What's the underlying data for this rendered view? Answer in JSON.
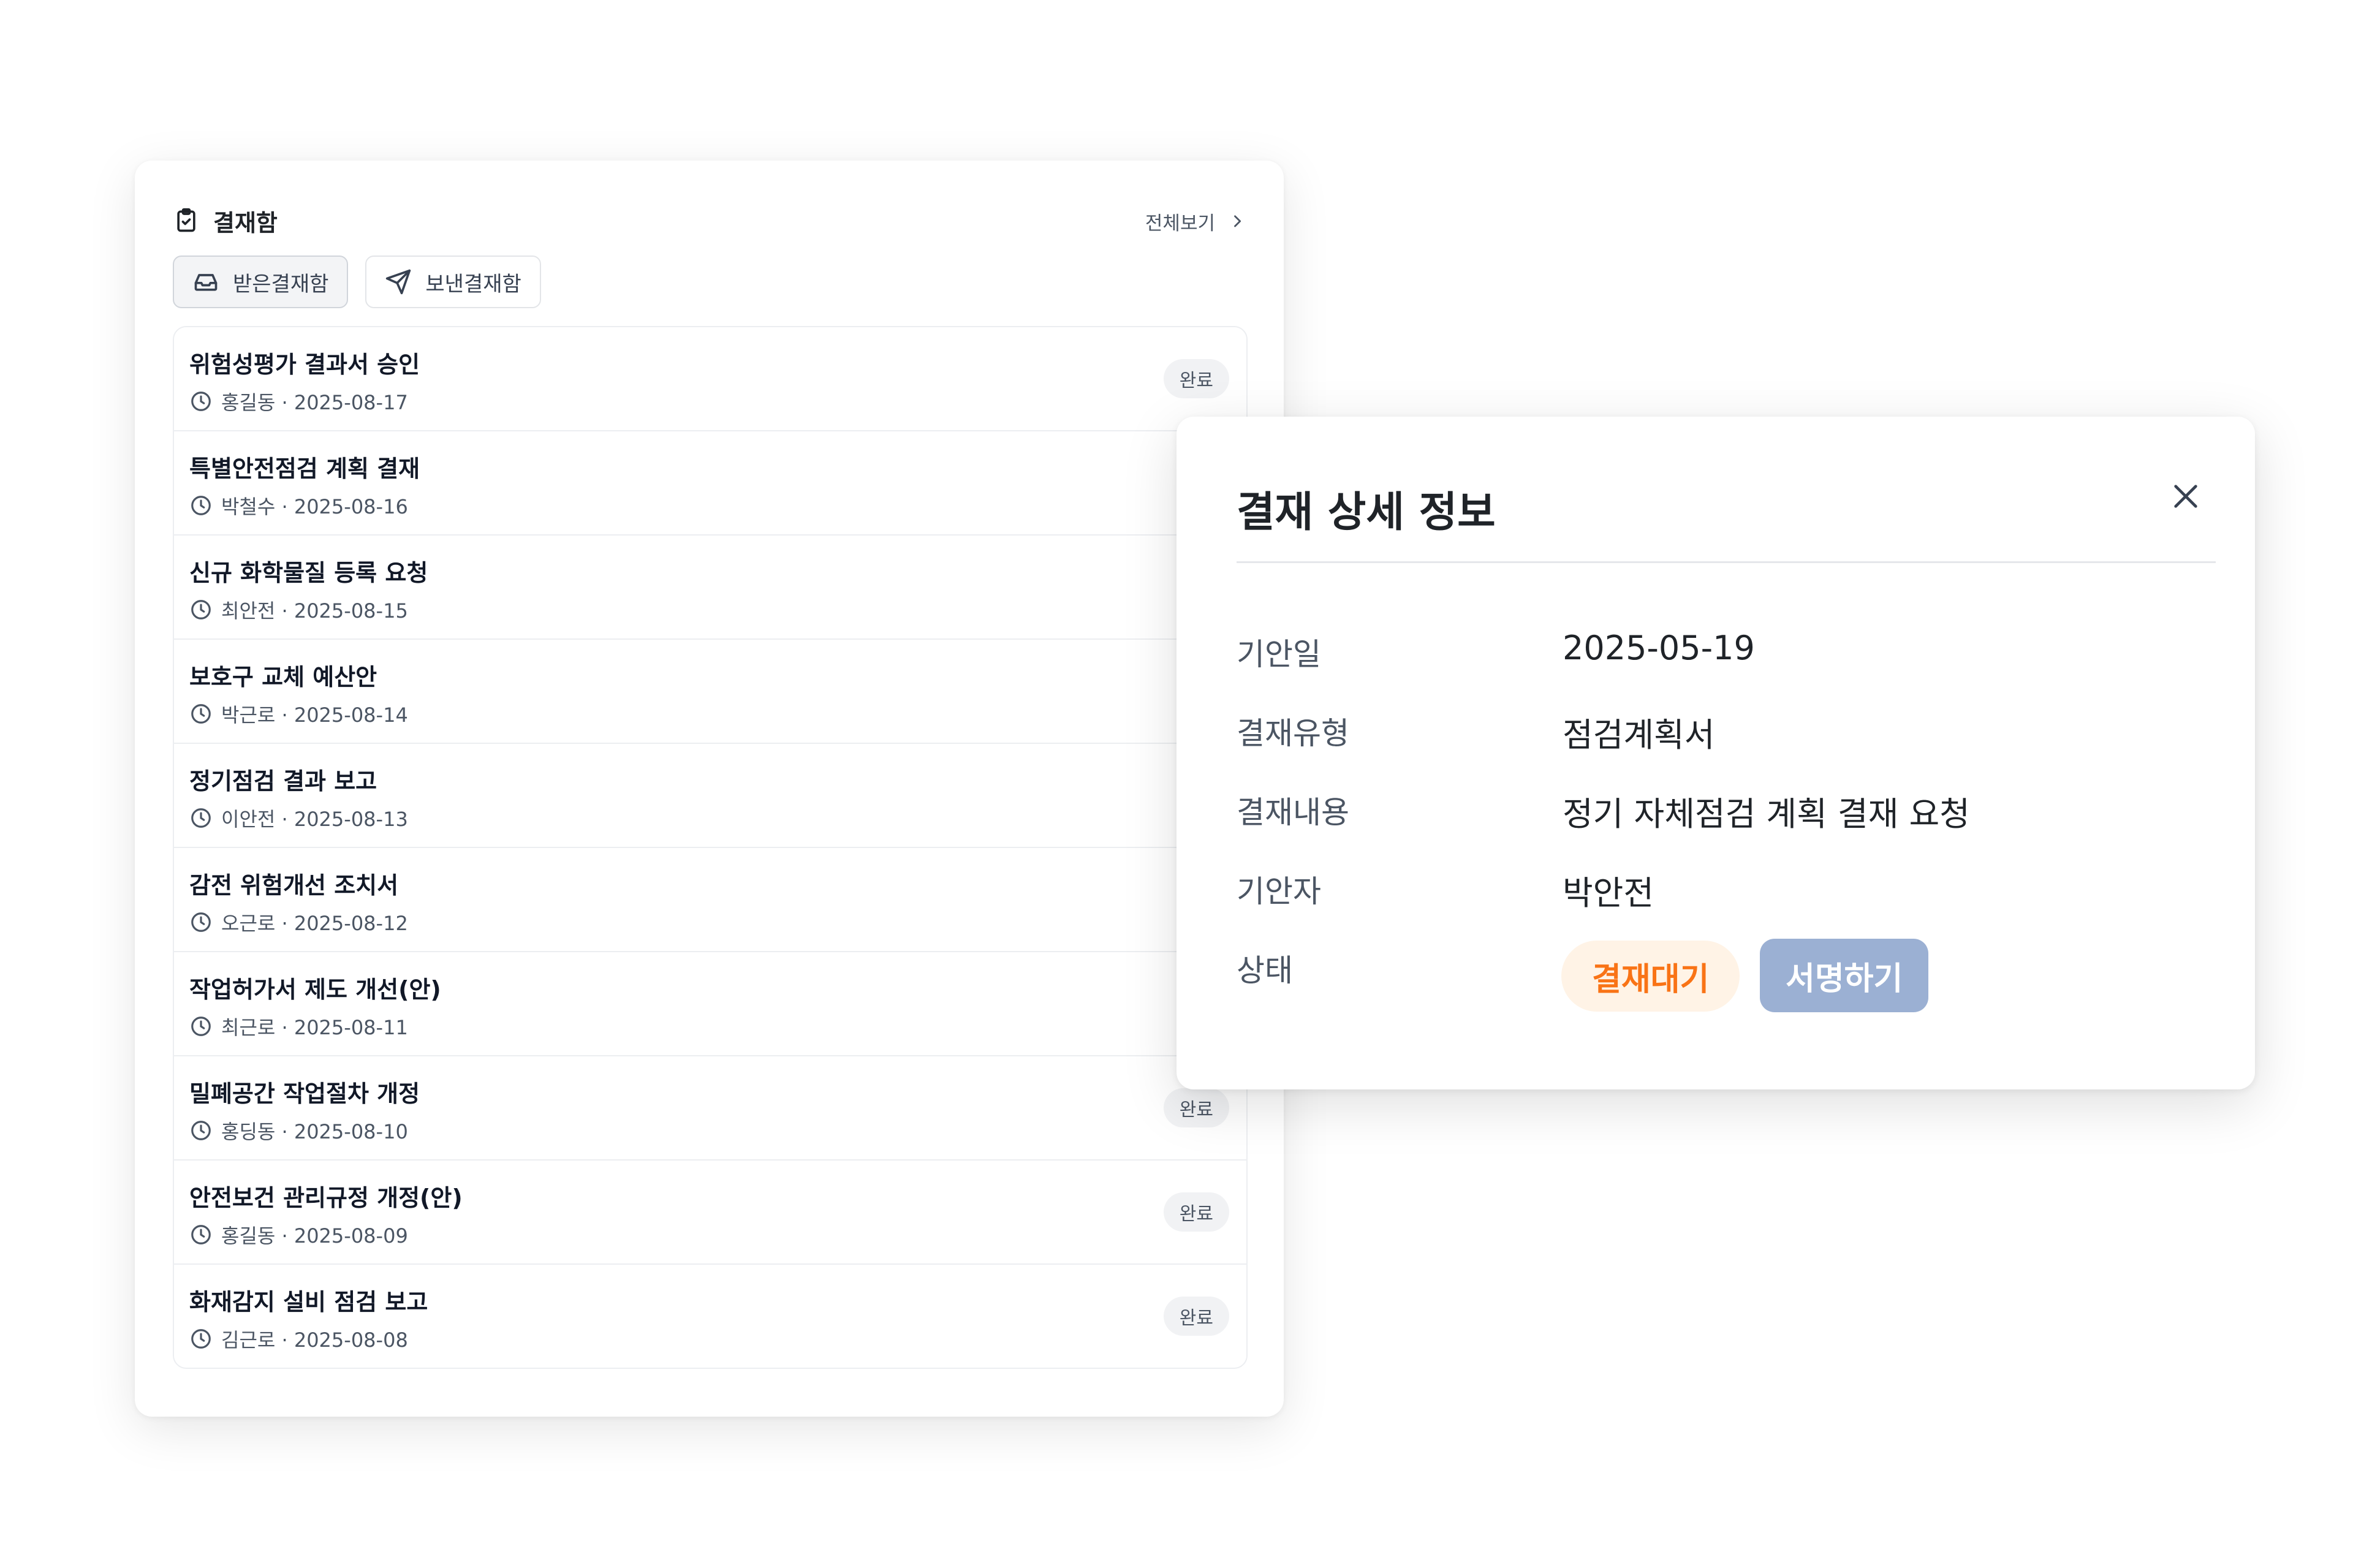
{
  "approval_box": {
    "title": "결재함",
    "view_all": "전체보기",
    "tabs": [
      {
        "label": "받은결재함",
        "icon": "inbox-icon",
        "active": true
      },
      {
        "label": "보낸결재함",
        "icon": "send-icon",
        "active": false
      }
    ],
    "items": [
      {
        "title": "위험성평가 결과서 승인",
        "meta": "홍길동 · 2025-08-17",
        "status": "완료"
      },
      {
        "title": "특별안전점검 계획 결재",
        "meta": "박철수 · 2025-08-16",
        "status": ""
      },
      {
        "title": "신규 화학물질 등록 요청",
        "meta": "최안전 · 2025-08-15",
        "status": ""
      },
      {
        "title": "보호구 교체 예산안",
        "meta": "박근로 · 2025-08-14",
        "status": ""
      },
      {
        "title": "정기점검 결과 보고",
        "meta": "이안전 · 2025-08-13",
        "status": ""
      },
      {
        "title": "감전 위험개선 조치서",
        "meta": "오근로 · 2025-08-12",
        "status": ""
      },
      {
        "title": "작업허가서 제도 개선(안)",
        "meta": "최근로 · 2025-08-11",
        "status": ""
      },
      {
        "title": "밀폐공간 작업절차 개정",
        "meta": "홍딩동 · 2025-08-10",
        "status": "완료"
      },
      {
        "title": "안전보건 관리규정 개정(안)",
        "meta": "홍길동 · 2025-08-09",
        "status": "완료"
      },
      {
        "title": "화재감지 설비 점검 보고",
        "meta": "김근로 · 2025-08-08",
        "status": "완료"
      }
    ]
  },
  "detail_modal": {
    "title": "결재 상세 정보",
    "fields": [
      {
        "label": "기안일",
        "value": "2025-05-19"
      },
      {
        "label": "결재유형",
        "value": "점검계획서"
      },
      {
        "label": "결재내용",
        "value": "정기 자체점검 계획 결재 요청"
      },
      {
        "label": "기안자",
        "value": "박안전"
      },
      {
        "label": "상태",
        "value": ""
      }
    ],
    "status_value": "결재대기",
    "sign_button": "서명하기"
  },
  "colors": {
    "pending": "#f97316",
    "pending_bg": "#fff3e6",
    "sign_button": "#9bb0d3",
    "done_badge_bg": "#f1f2f4"
  }
}
